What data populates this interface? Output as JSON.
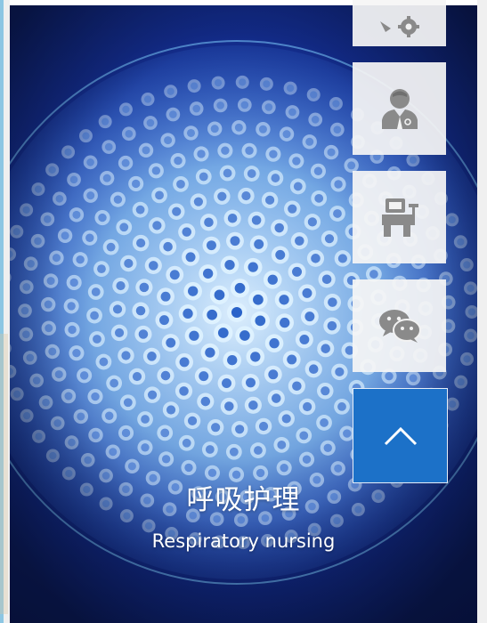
{
  "banner": {
    "title_cn": "呼吸护理",
    "title_en": "Respiratory nursing"
  },
  "floating_toolbar": {
    "buttons": [
      {
        "name": "settings",
        "icon": "gear-service-icon"
      },
      {
        "name": "doctor",
        "icon": "doctor-icon"
      },
      {
        "name": "device",
        "icon": "medical-device-icon"
      },
      {
        "name": "wechat",
        "icon": "wechat-icon"
      }
    ],
    "back_to_top": {
      "icon": "chevron-up-icon"
    }
  },
  "colors": {
    "banner_deep": "#0b1d66",
    "banner_mid": "#2d5fd6",
    "tube_light": "#cfeaff",
    "back_to_top": "#1c71c8",
    "icon_grey": "#8a8a8a"
  }
}
